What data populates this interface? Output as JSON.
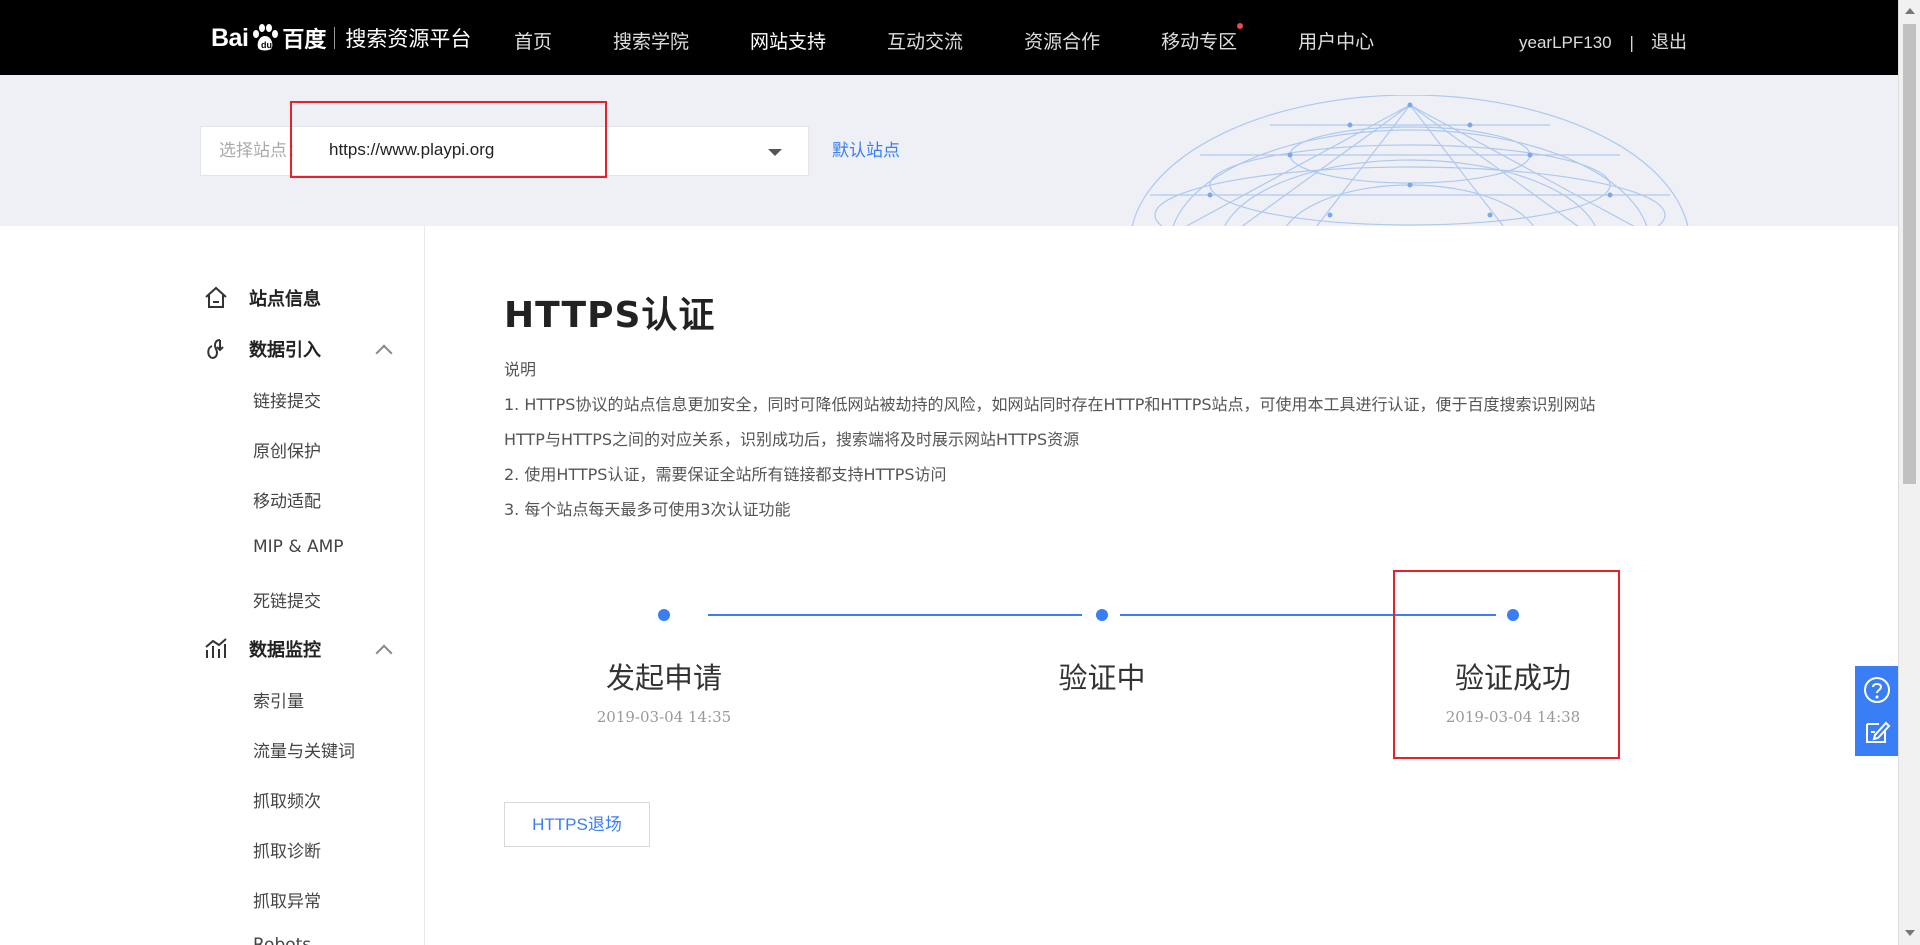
{
  "header": {
    "logo_text_bai": "Bai",
    "logo_text_du": "百度",
    "platform_name": "搜索资源平台",
    "nav": [
      {
        "label": "首页",
        "active": false
      },
      {
        "label": "搜索学院",
        "active": false
      },
      {
        "label": "网站支持",
        "active": true
      },
      {
        "label": "互动交流",
        "active": false
      },
      {
        "label": "资源合作",
        "active": false
      },
      {
        "label": "移动专区",
        "active": false,
        "badge_dot": true
      },
      {
        "label": "用户中心",
        "active": false
      }
    ],
    "username": "yearLPF130",
    "separator": "|",
    "logout_label": "退出"
  },
  "site_selector": {
    "label": "选择站点：",
    "value": "https://www.playpi.org",
    "default_site_link": "默认站点"
  },
  "sidebar": {
    "groups": [
      {
        "label": "站点信息",
        "icon": "home-icon",
        "items": []
      },
      {
        "label": "数据引入",
        "icon": "data-import-icon",
        "expanded": true,
        "items": [
          "链接提交",
          "原创保护",
          "移动适配",
          "MIP & AMP",
          "死链提交"
        ]
      },
      {
        "label": "数据监控",
        "icon": "data-monitor-icon",
        "expanded": true,
        "items": [
          "索引量",
          "流量与关键词",
          "抓取频次",
          "抓取诊断",
          "抓取异常",
          "Robots"
        ]
      }
    ]
  },
  "main": {
    "title": "HTTPS认证",
    "desc_heading": "说明",
    "desc_lines": [
      "1. HTTPS协议的站点信息更加安全，同时可降低网站被劫持的风险，如网站同时存在HTTP和HTTPS站点，可使用本工具进行认证，便于百度搜索识别网站",
      "HTTP与HTTPS之间的对应关系，识别成功后，搜索端将及时展示网站HTTPS资源",
      "2. 使用HTTPS认证，需要保证全站所有链接都支持HTTPS访问",
      "3. 每个站点每天最多可使用3次认证功能"
    ],
    "steps": [
      {
        "title": "发起申请",
        "time": "2019-03-04 14:35"
      },
      {
        "title": "验证中",
        "time": ""
      },
      {
        "title": "验证成功",
        "time": "2019-03-04 14:38"
      }
    ],
    "exit_button": "HTTPS退场"
  },
  "floating": {
    "buttons": [
      "help-icon",
      "feedback-icon"
    ]
  },
  "colors": {
    "accent": "#3a7ef5",
    "topbar": "#000000",
    "banner": "#eef0f6",
    "highlight_box": "#e8202a"
  }
}
